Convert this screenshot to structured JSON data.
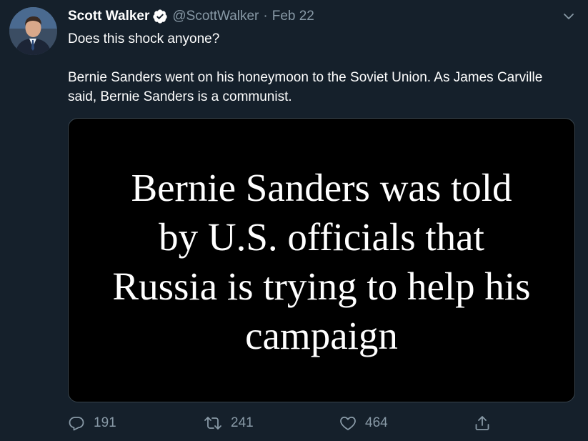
{
  "tweet": {
    "author": {
      "display_name": "Scott Walker",
      "handle": "@ScottWalker",
      "verified": true,
      "avatar_icon": "profile-photo"
    },
    "separator": "·",
    "date": "Feb 22",
    "text_lines": [
      "Does this shock anyone?",
      "Bernie Sanders went on his honeymoon to the Soviet Union. As James Carville said, Bernie Sanders is a communist."
    ],
    "media": {
      "headline_lines": [
        "Bernie Sanders was told",
        "by U.S. officials that",
        "Russia is trying to help his",
        "campaign"
      ]
    },
    "actions": {
      "reply": {
        "icon": "reply-icon",
        "count": "191"
      },
      "retweet": {
        "icon": "retweet-icon",
        "count": "241"
      },
      "like": {
        "icon": "heart-icon",
        "count": "464"
      },
      "share": {
        "icon": "share-icon"
      }
    }
  },
  "colors": {
    "background": "#15202b",
    "secondary_text": "#8899a6",
    "verified": "#ffffff",
    "media_border": "#38444d"
  }
}
